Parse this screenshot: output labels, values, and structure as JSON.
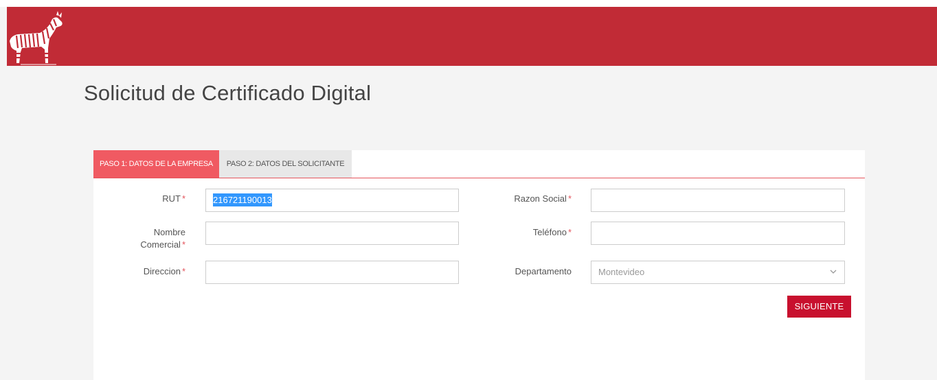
{
  "header": {
    "logo_icon": "zebra-logo-icon",
    "background_color": "#c12b36"
  },
  "page": {
    "title": "Solicitud de Certificado Digital"
  },
  "tabs": [
    {
      "label": "PASO 1: DATOS DE LA EMPRESA",
      "active": true,
      "color": "#f05a62"
    },
    {
      "label": "PASO 2: DATOS DEL SOLICITANTE",
      "active": false
    }
  ],
  "form": {
    "required_mark": "*",
    "rut": {
      "label": "RUT",
      "value": "216721190013",
      "selected": true
    },
    "razon_social": {
      "label": "Razon Social",
      "value": ""
    },
    "nombre_comercial": {
      "label_line1": "Nombre",
      "label_line2": "Comercial",
      "value": ""
    },
    "telefono": {
      "label": "Teléfono",
      "value": ""
    },
    "direccion": {
      "label": "Direccion",
      "value": ""
    },
    "departamento": {
      "label": "Departamento",
      "value": "Montevideo",
      "icon": "chevron-down-icon"
    }
  },
  "actions": {
    "next_label": "SIGUIENTE",
    "next_color": "#c8102e"
  }
}
